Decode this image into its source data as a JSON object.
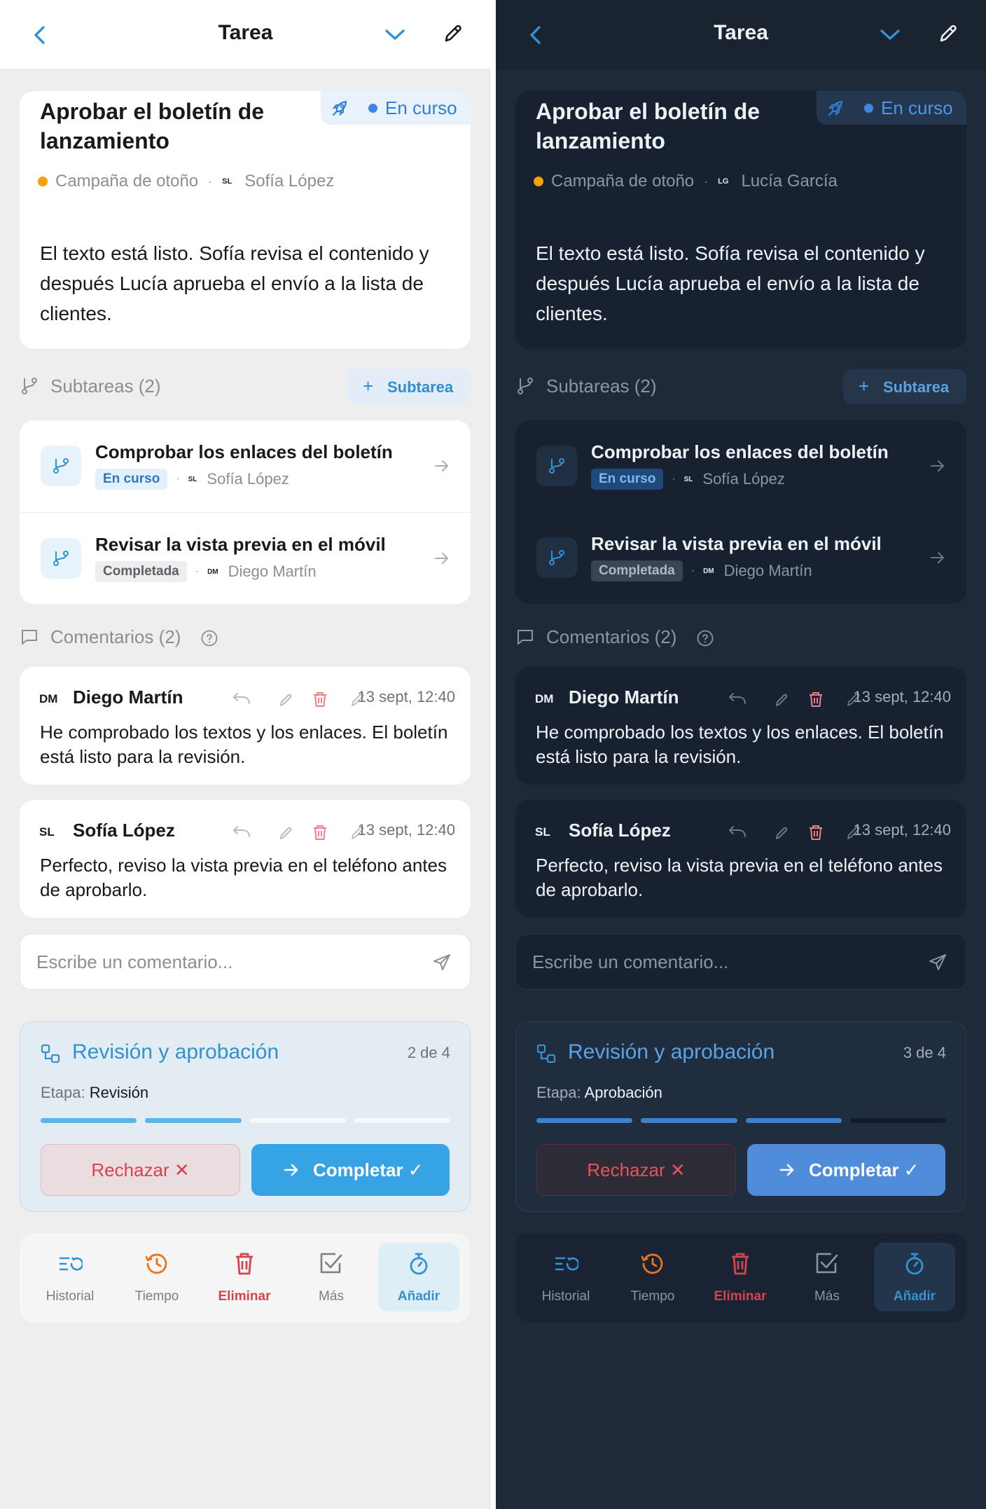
{
  "panels": {
    "light": {
      "header": {
        "title": "Tarea"
      },
      "task": {
        "title": "Aprobar el boletín de lanzamiento",
        "status": "En curso",
        "project": "Campaña de otoño",
        "assignee_initials": "SL",
        "assignee": "Sofía López",
        "description": "El texto está listo. Sofía revisa el contenido y después Lucía aprueba el envío a la lista de clientes."
      },
      "subtasks": {
        "heading": "Subtareas (2)",
        "add_label": "Subtarea",
        "items": [
          {
            "title": "Comprobar los enlaces del boletín",
            "status": "En curso",
            "initials": "SL",
            "assignee": "Sofía López"
          },
          {
            "title": "Revisar la vista previa en el móvil",
            "status": "Completada",
            "initials": "DM",
            "assignee": "Diego Martín"
          }
        ]
      },
      "comments": {
        "heading": "Comentarios (2)",
        "items": [
          {
            "initials": "DM",
            "author": "Diego Martín",
            "date": "13 sept, 12:40",
            "text": "He comprobado los textos y los enlaces. El boletín está listo para la revisión."
          },
          {
            "initials": "SL",
            "author": "Sofía López",
            "date": "13 sept, 12:40",
            "text": "Perfecto, reviso la vista previa en el teléfono antes de aprobarlo."
          }
        ],
        "placeholder": "Escribe un comentario..."
      },
      "workflow": {
        "title": "Revisión y aprobación",
        "count": "2 de 4",
        "stage_key": "Etapa:",
        "stage": "Revisión",
        "progress_done": 2,
        "progress_total": 4,
        "reject_label": "Rechazar ✕",
        "complete_label": "Completar ✓"
      },
      "tabs": [
        "Historial",
        "Tiempo",
        "Eliminar",
        "Más",
        "Añadir"
      ]
    },
    "dark": {
      "header": {
        "title": "Tarea"
      },
      "task": {
        "title": "Aprobar el boletín de lanzamiento",
        "status": "En curso",
        "project": "Campaña de otoño",
        "assignee_initials": "LG",
        "assignee": "Lucía García",
        "description": "El texto está listo. Sofía revisa el contenido y después Lucía aprueba el envío a la lista de clientes."
      },
      "subtasks": {
        "heading": "Subtareas (2)",
        "add_label": "Subtarea",
        "items": [
          {
            "title": "Comprobar los enlaces del boletín",
            "status": "En curso",
            "initials": "SL",
            "assignee": "Sofía López"
          },
          {
            "title": "Revisar la vista previa en el móvil",
            "status": "Completada",
            "initials": "DM",
            "assignee": "Diego Martín"
          }
        ]
      },
      "comments": {
        "heading": "Comentarios (2)",
        "items": [
          {
            "initials": "DM",
            "author": "Diego Martín",
            "date": "13 sept, 12:40",
            "text": "He comprobado los textos y los enlaces. El boletín está listo para la revisión."
          },
          {
            "initials": "SL",
            "author": "Sofía López",
            "date": "13 sept, 12:40",
            "text": "Perfecto, reviso la vista previa en el teléfono antes de aprobarlo."
          }
        ],
        "placeholder": "Escribe un comentario..."
      },
      "workflow": {
        "title": "Revisión y aprobación",
        "count": "3 de 4",
        "stage_key": "Etapa:",
        "stage": "Aprobación",
        "progress_done": 3,
        "progress_total": 4,
        "reject_label": "Rechazar ✕",
        "complete_label": "Completar ✓"
      },
      "tabs": [
        "Historial",
        "Tiempo",
        "Eliminar",
        "Más",
        "Añadir"
      ]
    }
  },
  "icons": [
    "chevron-left-icon",
    "chevron-down-icon",
    "pencil-icon",
    "rocket-icon",
    "branch-icon",
    "arrow-right-icon",
    "comment-icon",
    "help-icon",
    "reply-icon",
    "trash-icon",
    "send-icon",
    "workflow-icon",
    "history-icon",
    "clock-icon",
    "checkbox-icon",
    "timer-icon"
  ],
  "colors": {
    "accent_blue": "#3292d3",
    "status_blue": "#3b87e4",
    "project_orange": "#f59f0a",
    "danger_red": "#d9424c",
    "time_orange": "#e8741c"
  }
}
